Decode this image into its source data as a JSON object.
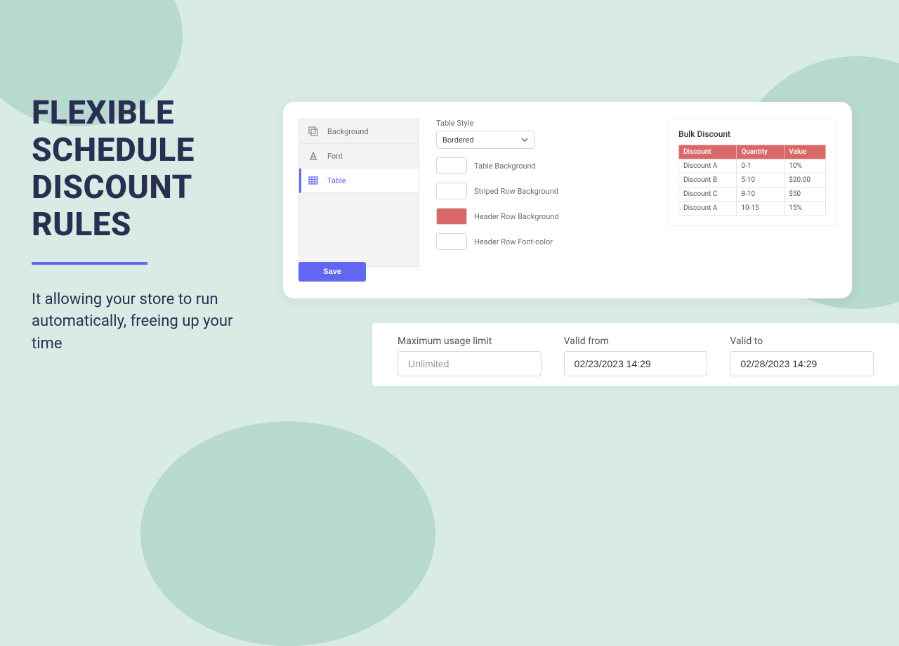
{
  "hero": {
    "title": "FLEXIBLE SCHEDULE DISCOUNT RULES",
    "subtitle": "It allowing your store to run automatically, freeing up your time"
  },
  "sidebar": {
    "items": [
      {
        "label": "Background"
      },
      {
        "label": "Font"
      },
      {
        "label": "Table"
      }
    ]
  },
  "save_label": "Save",
  "table_style": {
    "label": "Table Style",
    "value": "Bordered",
    "rows": [
      {
        "label": "Table Background"
      },
      {
        "label": "Striped Row Background"
      },
      {
        "label": "Header Row Background"
      },
      {
        "label": "Header Row Font-color"
      }
    ]
  },
  "preview": {
    "title": "Bulk Discount",
    "headers": [
      "Discount",
      "Quantity",
      "Value"
    ],
    "rows": [
      [
        "Discount A",
        "0-1",
        "10%"
      ],
      [
        "Discount B",
        "5-10",
        "$20.00"
      ],
      [
        "Discount C",
        "8-10",
        "$50"
      ],
      [
        "Discount A",
        "10-15",
        "15%"
      ]
    ]
  },
  "schedule": {
    "max_label": "Maximum usage limit",
    "max_placeholder": "Unlimited",
    "from_label": "Valid from",
    "from_value": "02/23/2023 14:29",
    "to_label": "Valid to",
    "to_value": "02/28/2023 14:29"
  }
}
